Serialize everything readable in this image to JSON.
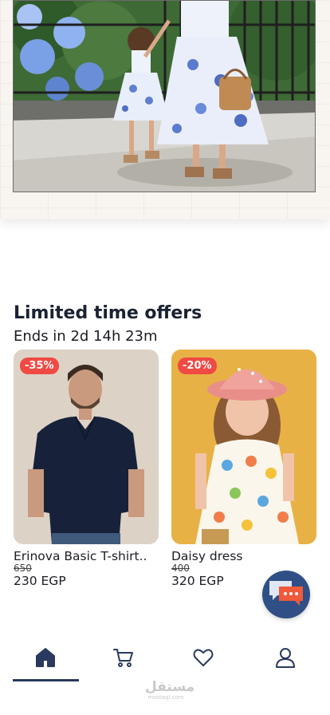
{
  "offers": {
    "title": "Limited time offers",
    "countdown": "Ends in 2d 14h 23m"
  },
  "products": [
    {
      "name": "Erinova Basic T-shirt..",
      "badge": "-35%",
      "old_price": "650",
      "price": "230 EGP"
    },
    {
      "name": "Daisy dress",
      "badge": "-20%",
      "old_price": "400",
      "price": "320 EGP"
    }
  ],
  "nav": {
    "items": [
      "home-icon",
      "cart-icon",
      "heart-icon",
      "user-icon"
    ],
    "active": "home-icon"
  },
  "watermark": {
    "main": "مستقل",
    "sub": "mostaql.com"
  },
  "colors": {
    "accent": "#2a3a5e",
    "badge": "#ef4a43",
    "chat": "#2f4f86"
  }
}
